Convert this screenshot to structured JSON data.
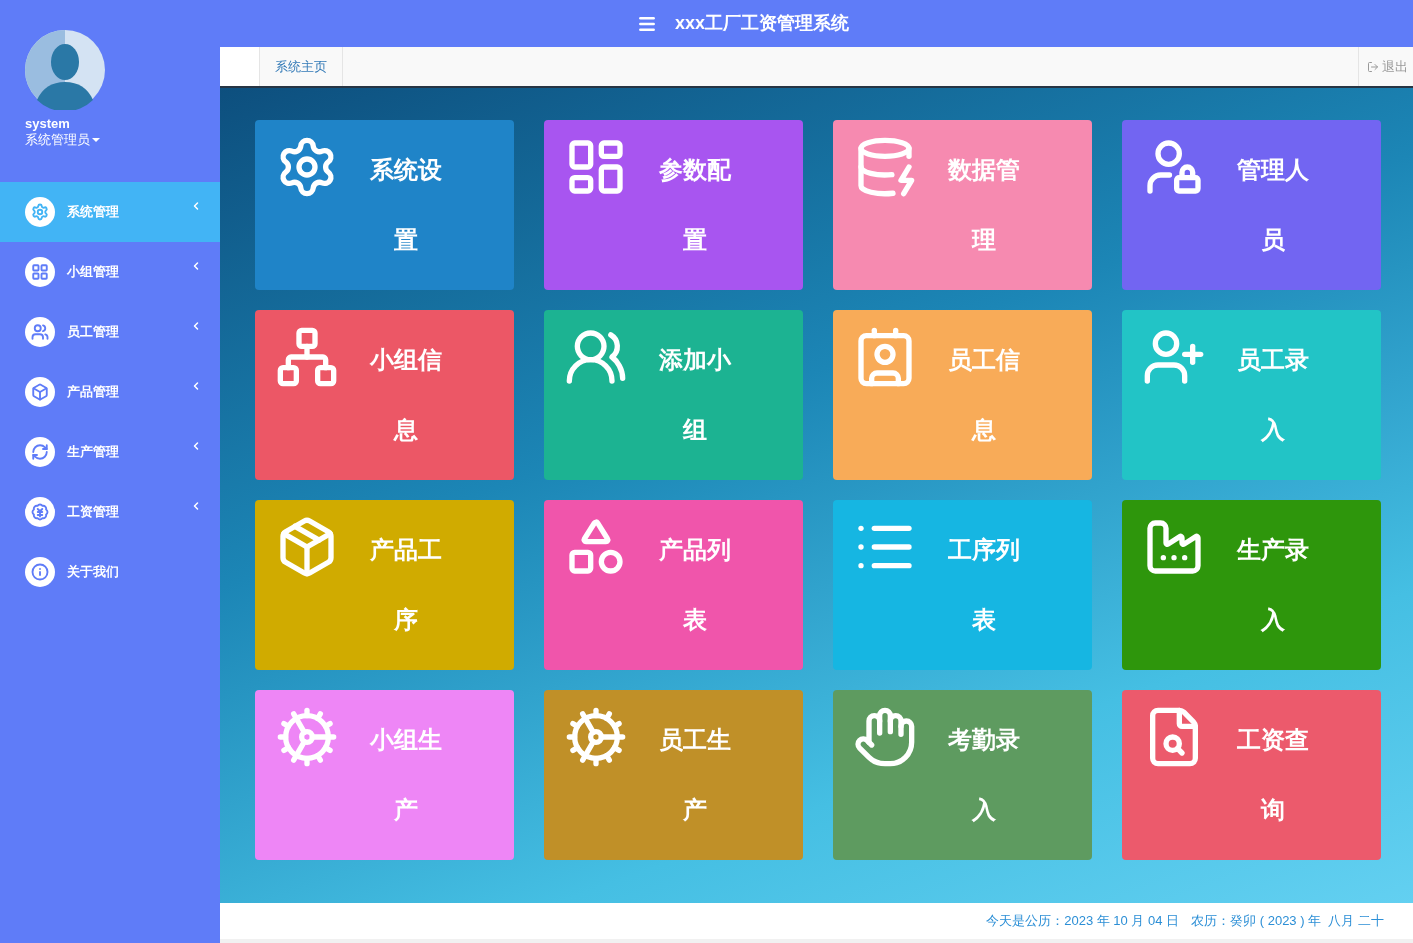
{
  "header": {
    "title": "xxx工厂工资管理系统"
  },
  "user": {
    "name": "system",
    "role": "系统管理员"
  },
  "sidebar": {
    "items": [
      {
        "label": "系统管理",
        "selected": true,
        "expandable": true
      },
      {
        "label": "小组管理",
        "selected": false,
        "expandable": true
      },
      {
        "label": "员工管理",
        "selected": false,
        "expandable": true
      },
      {
        "label": "产品管理",
        "selected": false,
        "expandable": true
      },
      {
        "label": "生产管理",
        "selected": false,
        "expandable": true
      },
      {
        "label": "工资管理",
        "selected": false,
        "expandable": true
      },
      {
        "label": "关于我们",
        "selected": false,
        "expandable": false
      }
    ]
  },
  "tabs": [
    {
      "label": "系统主页"
    }
  ],
  "logout": "退出",
  "tiles": [
    {
      "label": "系统设置",
      "color": "#1f84c8"
    },
    {
      "label": "参数配置",
      "color": "#a855f0"
    },
    {
      "label": "数据管理",
      "color": "#f68ab0"
    },
    {
      "label": "管理人员",
      "color": "#7265f2"
    },
    {
      "label": "小组信息",
      "color": "#ec5766"
    },
    {
      "label": "添加小组",
      "color": "#1cb392"
    },
    {
      "label": "员工信息",
      "color": "#f8ab58"
    },
    {
      "label": "员工录入",
      "color": "#22c4c6"
    },
    {
      "label": "产品工序",
      "color": "#d0ab00"
    },
    {
      "label": "产品列表",
      "color": "#f055ab"
    },
    {
      "label": "工序列表",
      "color": "#16b6e2"
    },
    {
      "label": "生产录入",
      "color": "#2e960c"
    },
    {
      "label": "小组生产",
      "color": "#ee86f6"
    },
    {
      "label": "员工生产",
      "color": "#c09028"
    },
    {
      "label": "考勤录入",
      "color": "#5e9b60"
    },
    {
      "label": "工资查询",
      "color": "#ec5a6c"
    }
  ],
  "footer": {
    "solar": "今天是公历：2023 年 10 月 04 日",
    "lunar": "农历：癸卯 ( 2023 ) 年  八月 二十"
  }
}
